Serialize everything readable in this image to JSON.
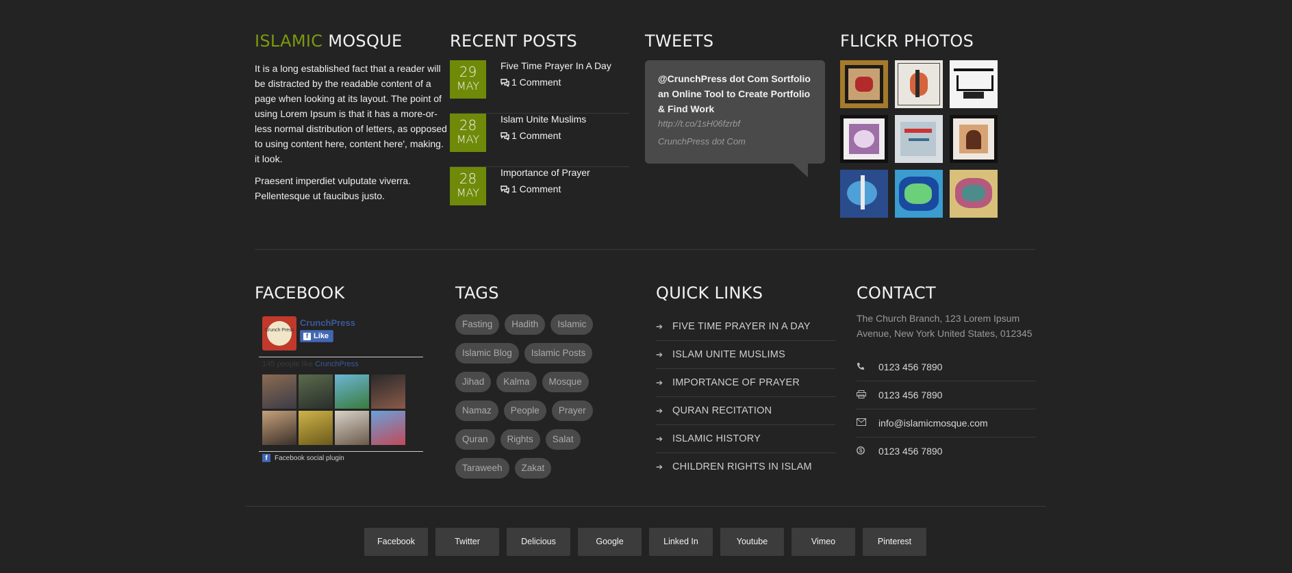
{
  "about": {
    "title_accent": "ISLAMIC",
    "title_rest": "MOSQUE",
    "p1": "It is a long established fact that a reader will be distracted by the readable content of a page when looking at its layout. The point of using Lorem Ipsum is that it has a more-or-less normal distribution of letters, as opposed to using content here, content here', making. it look.",
    "p2": "Praesent imperdiet vulputate viverra. Pellentesque ut faucibus justo."
  },
  "recent_posts": {
    "title": "RECENT POSTS",
    "items": [
      {
        "day": "29",
        "month": "MAY",
        "title": "Five Time Prayer In A Day",
        "comments": "1 Comment"
      },
      {
        "day": "28",
        "month": "MAY",
        "title": "Islam Unite Muslims",
        "comments": "1 Comment"
      },
      {
        "day": "28",
        "month": "MAY",
        "title": "Importance of Prayer",
        "comments": "1 Comment"
      }
    ]
  },
  "tweets": {
    "title": "TWEETS",
    "text": "@CrunchPress dot Com Sortfolio an Online Tool to Create Portfolio & Find Work",
    "link": "http://t.co/1sH06fzrbf",
    "author": "CrunchPress dot Com"
  },
  "flickr": {
    "title": "FLICKR PHOTOS",
    "photos": [
      "calligraphy-1",
      "calligraphy-2",
      "calligraphy-3",
      "calligraphy-4",
      "calligraphy-5",
      "calligraphy-6",
      "calligraphy-7",
      "calligraphy-8",
      "calligraphy-9"
    ]
  },
  "facebook": {
    "title": "FACEBOOK",
    "page_name": "CrunchPress",
    "logo_text": "Crunch Press",
    "like": "Like",
    "people_prefix": "145 people like",
    "people_link": "CrunchPress",
    "plugin": "Facebook social plugin",
    "fb_letter": "f"
  },
  "tags": {
    "title": "TAGS",
    "items": [
      "Fasting",
      "Hadith",
      "Islamic",
      "Islamic Blog",
      "Islamic Posts",
      "Jihad",
      "Kalma",
      "Mosque",
      "Namaz",
      "People",
      "Prayer",
      "Quran",
      "Rights",
      "Salat",
      "Taraweeh",
      "Zakat"
    ]
  },
  "quick_links": {
    "title": "QUICK LINKS",
    "items": [
      "FIVE TIME PRAYER IN A DAY",
      "ISLAM UNITE MUSLIMS",
      "IMPORTANCE OF PRAYER",
      "QURAN RECITATION",
      "ISLAMIC HISTORY",
      "CHILDREN RIGHTS IN ISLAM"
    ]
  },
  "contact": {
    "title": "CONTACT",
    "address": "The Church Branch, 123 Lorem Ipsum Avenue, New York United States, 012345",
    "items": [
      {
        "icon": "phone-icon",
        "text": "0123 456 7890"
      },
      {
        "icon": "print-icon",
        "text": "0123 456 7890"
      },
      {
        "icon": "envelope-icon",
        "text": "info@islamicmosque.com"
      },
      {
        "icon": "skype-icon",
        "text": "0123 456 7890"
      }
    ]
  },
  "social": [
    "Facebook",
    "Twitter",
    "Delicious",
    "Google",
    "Linked In",
    "Youtube",
    "Vimeo",
    "Pinterest"
  ],
  "colors": {
    "accent": "#7c9a0f",
    "date_box": "#6f8a09",
    "background": "#232323"
  }
}
